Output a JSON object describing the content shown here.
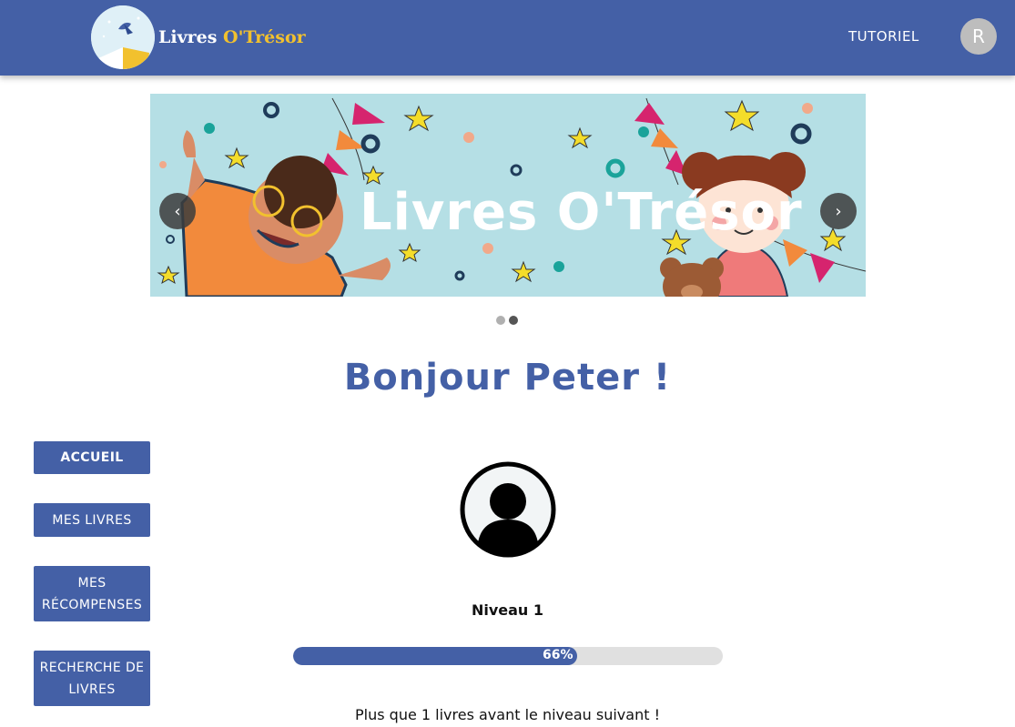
{
  "header": {
    "logo_text_part1": "Livres ",
    "logo_text_part2": "O'Trésor",
    "tutorial_label": "TUTORIEL",
    "user_initial": "R"
  },
  "banner": {
    "title": "Livres O'Trésor",
    "prev_icon": "chevron-left-icon",
    "next_icon": "chevron-right-icon",
    "slides": 2,
    "active_slide": 2
  },
  "greeting": "Bonjour Peter !",
  "sidebar": {
    "items": [
      {
        "label": "ACCUEIL"
      },
      {
        "label": "MES LIVRES"
      },
      {
        "label": "MES RÉCOMPENSES"
      },
      {
        "label": "RECHERCHE DE LIVRES"
      }
    ]
  },
  "profile": {
    "avatar_icon": "user-avatar-icon",
    "level_label": "Niveau 1",
    "progress_percent": 66,
    "progress_label": "66%",
    "next_level_text": "Plus que 1 livres avant le niveau suivant !"
  },
  "colors": {
    "brand": "#4460a6",
    "banner_bg": "#b5dfe5",
    "logo_accent": "#f2c12e"
  }
}
